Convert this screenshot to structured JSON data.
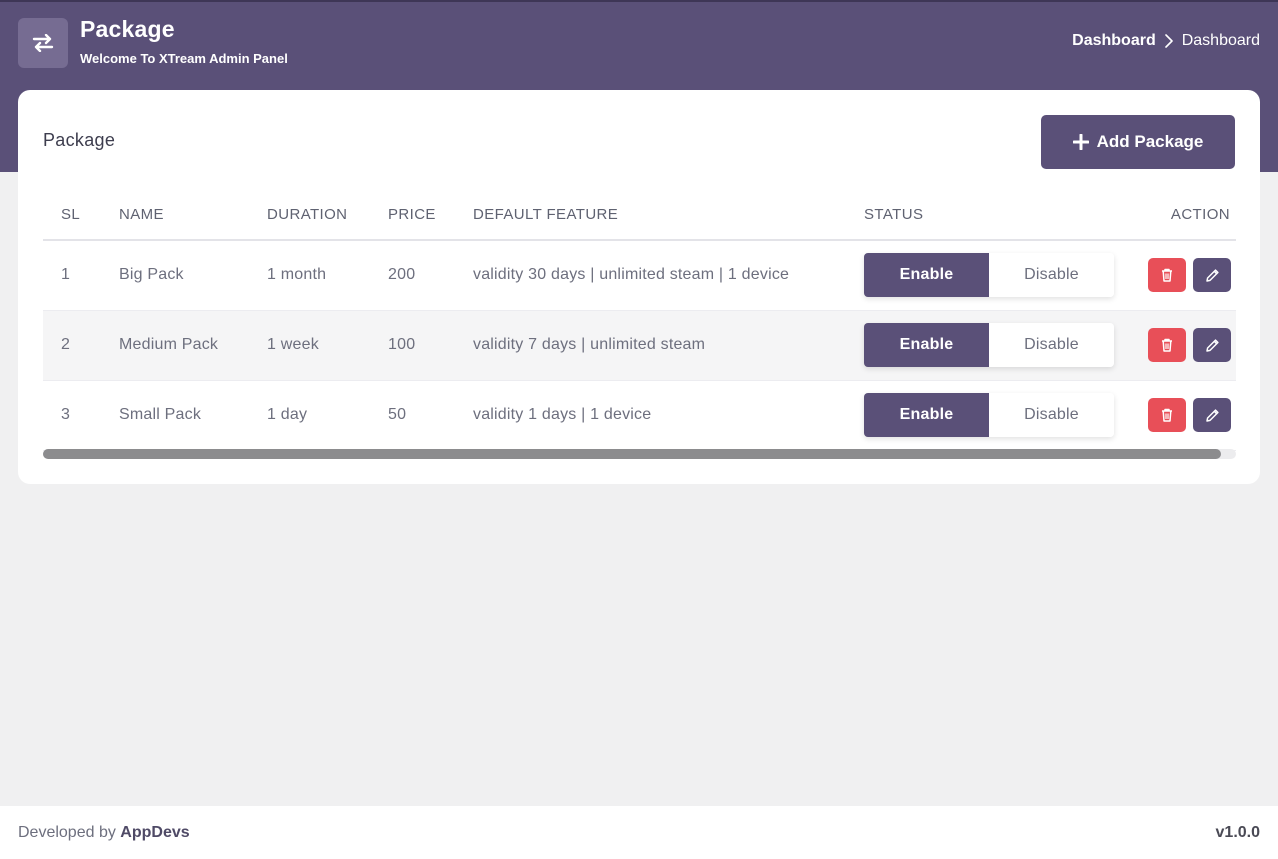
{
  "header": {
    "title": "Package",
    "subtitle": "Welcome To XTream Admin Panel",
    "menu_icon": "swap-arrows-icon",
    "breadcrumb": {
      "link": "Dashboard",
      "separator_icon": "chevron-right-icon",
      "current": "Dashboard"
    }
  },
  "card": {
    "title": "Package",
    "add_button_label": "Add Package"
  },
  "table": {
    "columns": {
      "sl": "SL",
      "name": "NAME",
      "duration": "DURATION",
      "price": "PRICE",
      "feature": "DEFAULT FEATURE",
      "status": "STATUS",
      "action": "ACTION"
    },
    "rows": [
      {
        "sl": "1",
        "name": "Big Pack",
        "duration": "1 month",
        "price": "200",
        "feature": "validity 30 days | unlimited steam | 1 device",
        "enable": "Enable",
        "disable": "Disable",
        "status": "Enable"
      },
      {
        "sl": "2",
        "name": "Medium Pack",
        "duration": "1 week",
        "price": "100",
        "feature": "validity 7 days | unlimited steam",
        "enable": "Enable",
        "disable": "Disable",
        "status": "Enable"
      },
      {
        "sl": "3",
        "name": "Small Pack",
        "duration": "1 day",
        "price": "50",
        "feature": "validity 1 days | 1 device",
        "enable": "Enable",
        "disable": "Disable",
        "status": "Enable"
      }
    ]
  },
  "footer": {
    "developed_by": "Developed by",
    "brand": "AppDevs",
    "version": "v1.0.0"
  },
  "colors": {
    "primary": "#5a5078",
    "danger": "#e84f58",
    "background": "#f0f0f1"
  }
}
